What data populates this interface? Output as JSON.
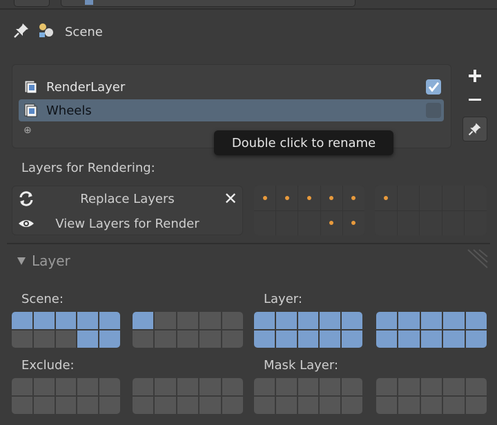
{
  "header": {
    "context_label": "Scene"
  },
  "render_layers": {
    "items": [
      {
        "label": "RenderLayer",
        "enabled": true,
        "selected": false
      },
      {
        "label": "Wheels",
        "enabled": false,
        "selected": true
      }
    ]
  },
  "tooltip": {
    "text": "Double click to rename"
  },
  "layers_for_rendering": {
    "caption": "Layers for Rendering:",
    "replace_label": "Replace Layers",
    "view_label": "View Layers for Render",
    "grid_a_dots": [
      [
        true,
        true,
        true,
        true,
        true
      ],
      [
        false,
        false,
        false,
        true,
        true
      ]
    ],
    "grid_b_dots": [
      [
        true,
        false,
        false,
        false,
        false
      ],
      [
        false,
        false,
        false,
        false,
        false
      ]
    ]
  },
  "layer_panel": {
    "title": "Layer",
    "scene_caption": "Scene:",
    "layer_caption": "Layer:",
    "exclude_caption": "Exclude:",
    "mask_caption": "Mask Layer:",
    "scene_grid_a": [
      [
        1,
        1,
        1,
        1,
        1
      ],
      [
        0,
        0,
        0,
        1,
        1
      ]
    ],
    "scene_grid_b": [
      [
        1,
        0,
        0,
        0,
        0
      ],
      [
        0,
        0,
        0,
        0,
        0
      ]
    ],
    "layer_grid_a": [
      [
        1,
        1,
        1,
        1,
        1
      ],
      [
        1,
        1,
        1,
        1,
        1
      ]
    ],
    "layer_grid_b": [
      [
        1,
        1,
        1,
        1,
        1
      ],
      [
        1,
        1,
        1,
        1,
        1
      ]
    ],
    "exclude_grid_a": [
      [
        0,
        0,
        0,
        0,
        0
      ],
      [
        0,
        0,
        0,
        0,
        0
      ]
    ],
    "exclude_grid_b": [
      [
        0,
        0,
        0,
        0,
        0
      ],
      [
        0,
        0,
        0,
        0,
        0
      ]
    ],
    "mask_grid_a": [
      [
        0,
        0,
        0,
        0,
        0
      ],
      [
        0,
        0,
        0,
        0,
        0
      ]
    ],
    "mask_grid_b": [
      [
        0,
        0,
        0,
        0,
        0
      ],
      [
        0,
        0,
        0,
        0,
        0
      ]
    ]
  },
  "colors": {
    "accent_blue": "#7a9fce",
    "dot_orange": "#e89a3c",
    "selected_row": "#56687a"
  }
}
